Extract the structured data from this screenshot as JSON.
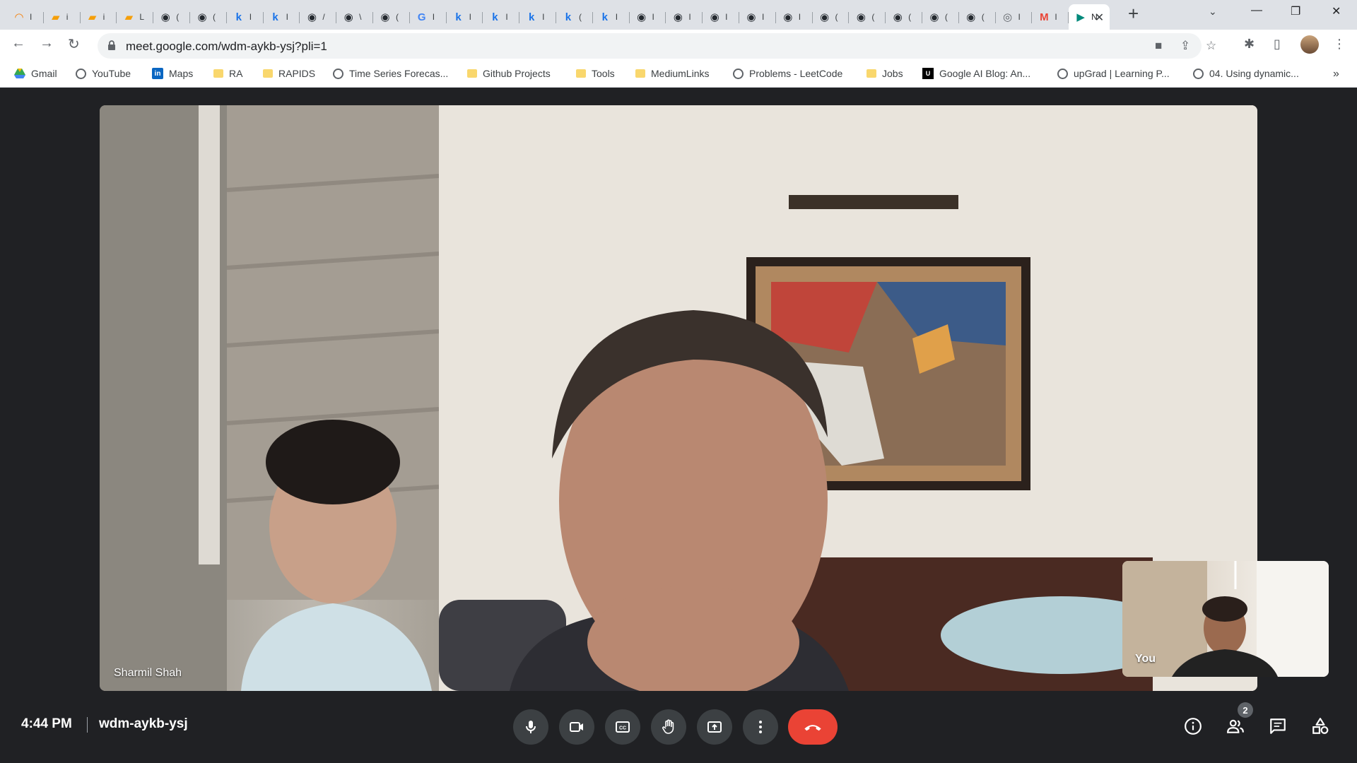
{
  "browser": {
    "tabs": [
      {
        "icon": "loader-icon",
        "glyph": "◠",
        "color": "#f57c00",
        "title": "I"
      },
      {
        "icon": "book-icon",
        "glyph": "▰",
        "color": "#f59f0a",
        "title": "i"
      },
      {
        "icon": "book-icon",
        "glyph": "▰",
        "color": "#f59f0a",
        "title": "i"
      },
      {
        "icon": "book-icon",
        "glyph": "▰",
        "color": "#f59f0a",
        "title": "L"
      },
      {
        "icon": "github-icon",
        "glyph": "◉",
        "color": "#24292f",
        "title": "("
      },
      {
        "icon": "github-icon",
        "glyph": "◉",
        "color": "#24292f",
        "title": "("
      },
      {
        "icon": "k-icon",
        "glyph": "k",
        "color": "#1a73e8",
        "title": "I"
      },
      {
        "icon": "k-icon",
        "glyph": "k",
        "color": "#1a73e8",
        "title": "I"
      },
      {
        "icon": "github-icon",
        "glyph": "◉",
        "color": "#24292f",
        "title": "/"
      },
      {
        "icon": "github-icon",
        "glyph": "◉",
        "color": "#24292f",
        "title": "\\"
      },
      {
        "icon": "github-icon",
        "glyph": "◉",
        "color": "#24292f",
        "title": "("
      },
      {
        "icon": "google-icon",
        "glyph": "G",
        "color": "#4285f4",
        "title": "I"
      },
      {
        "icon": "k-icon",
        "glyph": "k",
        "color": "#1a73e8",
        "title": "I"
      },
      {
        "icon": "k-icon",
        "glyph": "k",
        "color": "#1a73e8",
        "title": "I"
      },
      {
        "icon": "k-icon",
        "glyph": "k",
        "color": "#1a73e8",
        "title": "I"
      },
      {
        "icon": "k-icon",
        "glyph": "k",
        "color": "#1a73e8",
        "title": "("
      },
      {
        "icon": "k-icon",
        "glyph": "k",
        "color": "#1a73e8",
        "title": "I"
      },
      {
        "icon": "github-icon",
        "glyph": "◉",
        "color": "#24292f",
        "title": "I"
      },
      {
        "icon": "github-icon",
        "glyph": "◉",
        "color": "#24292f",
        "title": "I"
      },
      {
        "icon": "github-icon",
        "glyph": "◉",
        "color": "#24292f",
        "title": "I"
      },
      {
        "icon": "github-icon",
        "glyph": "◉",
        "color": "#24292f",
        "title": "I"
      },
      {
        "icon": "github-icon",
        "glyph": "◉",
        "color": "#24292f",
        "title": "I"
      },
      {
        "icon": "github-icon",
        "glyph": "◉",
        "color": "#24292f",
        "title": "("
      },
      {
        "icon": "github-icon",
        "glyph": "◉",
        "color": "#24292f",
        "title": "("
      },
      {
        "icon": "github-icon",
        "glyph": "◉",
        "color": "#24292f",
        "title": "("
      },
      {
        "icon": "github-icon",
        "glyph": "◉",
        "color": "#24292f",
        "title": "("
      },
      {
        "icon": "github-icon",
        "glyph": "◉",
        "color": "#24292f",
        "title": "("
      },
      {
        "icon": "chrome-icon",
        "glyph": "◎",
        "color": "#5f6368",
        "title": "I"
      },
      {
        "icon": "gmail-icon",
        "glyph": "M",
        "color": "#ea4335",
        "title": "I"
      }
    ],
    "active_tab": {
      "title": "N",
      "icon": "meet-icon"
    },
    "url": "meet.google.com/wdm-aykb-ysj?pli=1",
    "bookmarks": [
      {
        "label": "Gmail",
        "icon": "drive-icon"
      },
      {
        "label": "YouTube",
        "icon": "globe-icon"
      },
      {
        "label": "Maps",
        "icon": "linkedin-icon"
      },
      {
        "label": "RA",
        "icon": "folder-icon"
      },
      {
        "label": "RAPIDS",
        "icon": "folder-icon"
      },
      {
        "label": "Time Series Forecas...",
        "icon": "globe-icon"
      },
      {
        "label": "Github Projects",
        "icon": "folder-icon"
      },
      {
        "label": "Tools",
        "icon": "folder-icon"
      },
      {
        "label": "MediumLinks",
        "icon": "folder-icon"
      },
      {
        "label": "Problems - LeetCode",
        "icon": "globe-icon"
      },
      {
        "label": "Jobs",
        "icon": "folder-icon"
      },
      {
        "label": "Google AI Blog: An...",
        "icon": "uber-icon"
      },
      {
        "label": "upGrad | Learning P...",
        "icon": "globe-icon"
      },
      {
        "label": "04. Using dynamic...",
        "icon": "globe-icon"
      }
    ]
  },
  "meet": {
    "main_participant_name": "Sharmil Shah",
    "self_label": "You",
    "time": "4:44 PM",
    "meeting_code": "wdm-aykb-ysj",
    "participant_count": "2",
    "end_call_color": "#ea4335"
  }
}
